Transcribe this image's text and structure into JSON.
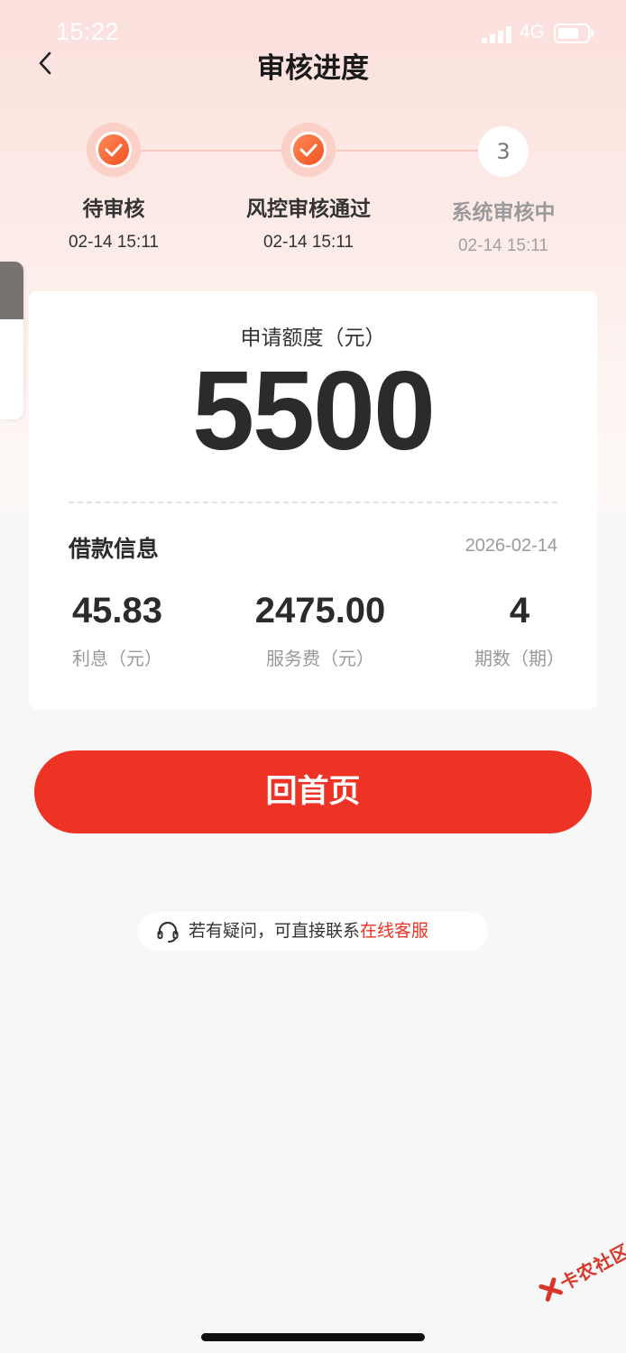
{
  "status_bar": {
    "time": "15:22",
    "network": "4G"
  },
  "nav": {
    "title": "审核进度",
    "back_icon": "chevron-left-icon"
  },
  "steps": [
    {
      "label": "待审核",
      "time": "02-14 15:11",
      "state": "done"
    },
    {
      "label": "风控审核通过",
      "time": "02-14 15:11",
      "state": "done"
    },
    {
      "label": "系统审核中",
      "time": "02-14 15:11",
      "state": "pending",
      "number": "3"
    }
  ],
  "amount": {
    "label": "申请额度（元）",
    "value": "5500"
  },
  "loan_info": {
    "title": "借款信息",
    "date": "2026-02-14",
    "stats": [
      {
        "value": "45.83",
        "label": "利息（元）"
      },
      {
        "value": "2475.00",
        "label": "服务费（元）"
      },
      {
        "value": "4",
        "label": "期数（期）"
      }
    ]
  },
  "home_button": {
    "label": "回首页"
  },
  "service": {
    "text": "若有疑问，可直接联系",
    "link": "在线客服",
    "icon": "headset-icon"
  },
  "watermark": {
    "text": "卡农社区"
  },
  "colors": {
    "accent": "#ec3324",
    "step_done": "#f4511e",
    "background": "#f7f7f7"
  }
}
